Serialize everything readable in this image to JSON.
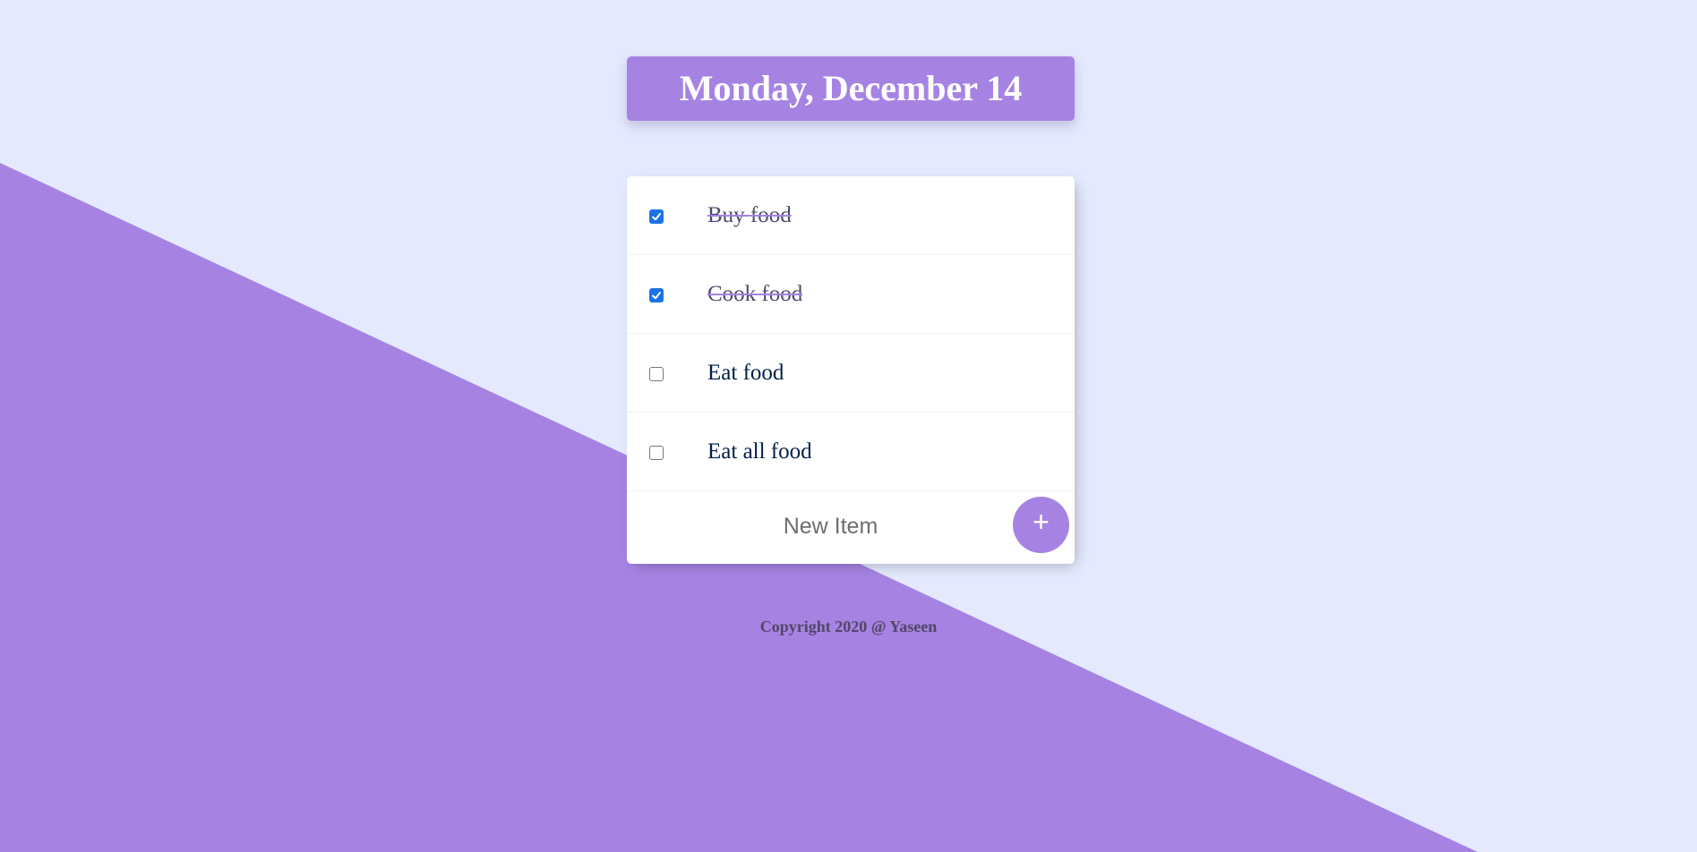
{
  "heading": {
    "date": "Monday, December 14"
  },
  "items": [
    {
      "label": "Buy food",
      "checked": true
    },
    {
      "label": "Cook food",
      "checked": true
    },
    {
      "label": "Eat food",
      "checked": false
    },
    {
      "label": "Eat all food",
      "checked": false
    }
  ],
  "new_item": {
    "placeholder": "New Item",
    "add_label": "+"
  },
  "footer": {
    "copyright": "Copyright 2020 @ Yaseen"
  },
  "colors": {
    "background": "#E4E9FD",
    "accent": "#A683E3",
    "text": "#00204A",
    "checkbox": "#1A73E8"
  },
  "icons": {
    "check": "check-icon",
    "add": "plus-icon"
  }
}
